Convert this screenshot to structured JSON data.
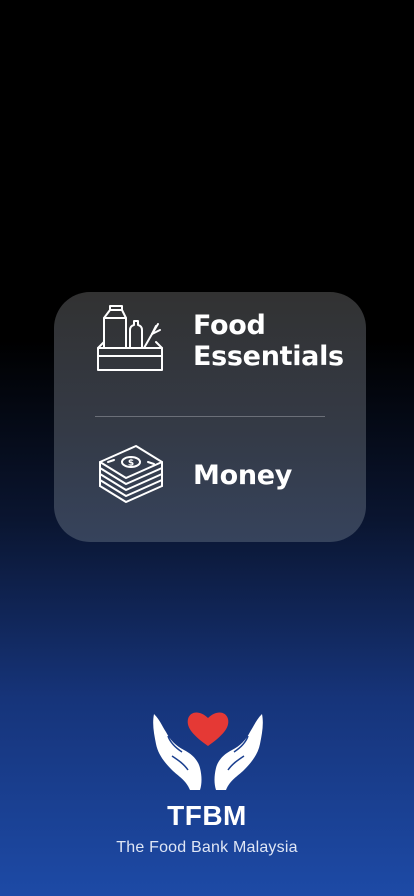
{
  "options": [
    {
      "label_line1": "Food",
      "label_line2": "Essentials",
      "icon": "grocery-box-icon"
    },
    {
      "label": "Money",
      "icon": "cash-stack-icon"
    }
  ],
  "brand": {
    "name": "TFBM",
    "subtitle": "The Food Bank Malaysia",
    "logo_icon": "heart-hands-icon",
    "heart_color": "#e53935"
  },
  "colors": {
    "background_top": "#000000",
    "background_bottom": "#1d4aa6",
    "card": "#333840",
    "text": "#ffffff"
  }
}
